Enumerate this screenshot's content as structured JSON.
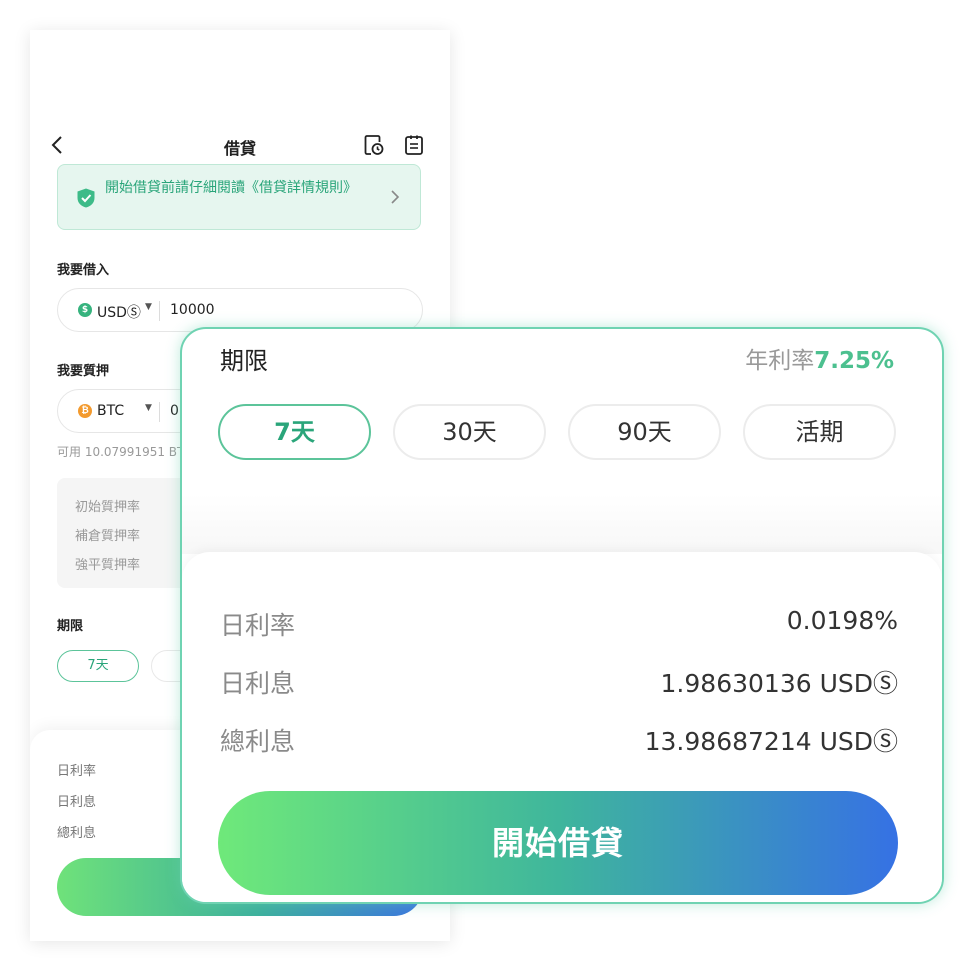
{
  "header": {
    "title": "借貸"
  },
  "notice": {
    "text": "開始借貸前請仔細閱讀《借貸詳情規則》"
  },
  "borrow": {
    "label": "我要借入",
    "currency": "USDⓈ",
    "amount": "10000"
  },
  "collateral": {
    "label": "我要質押",
    "currency": "BTC",
    "amount_partial": "0.",
    "available_partial": "可用 10.07991951 BT"
  },
  "ratios": [
    "初始質押率",
    "補倉質押率",
    "強平質押率"
  ],
  "term_small": {
    "label": "期限",
    "selected": "7天"
  },
  "summary_small": [
    "日利率",
    "日利息",
    "總利息"
  ],
  "card": {
    "term_label": "期限",
    "annual_rate_label": "年利率",
    "annual_rate_value": "7.25%",
    "durations": [
      "7天",
      "30天",
      "90天",
      "活期"
    ],
    "selected_duration": "7天",
    "rows": [
      {
        "key": "日利率",
        "value": "0.0198%"
      },
      {
        "key": "日利息",
        "value": "1.98630136 USDⓈ"
      },
      {
        "key": "總利息",
        "value": "13.98687214 USDⓈ"
      }
    ],
    "cta_label": "開始借貸"
  },
  "colors": {
    "accent": "#4cc08f",
    "gradient_start": "#6fe97a",
    "gradient_end": "#3671e4"
  }
}
